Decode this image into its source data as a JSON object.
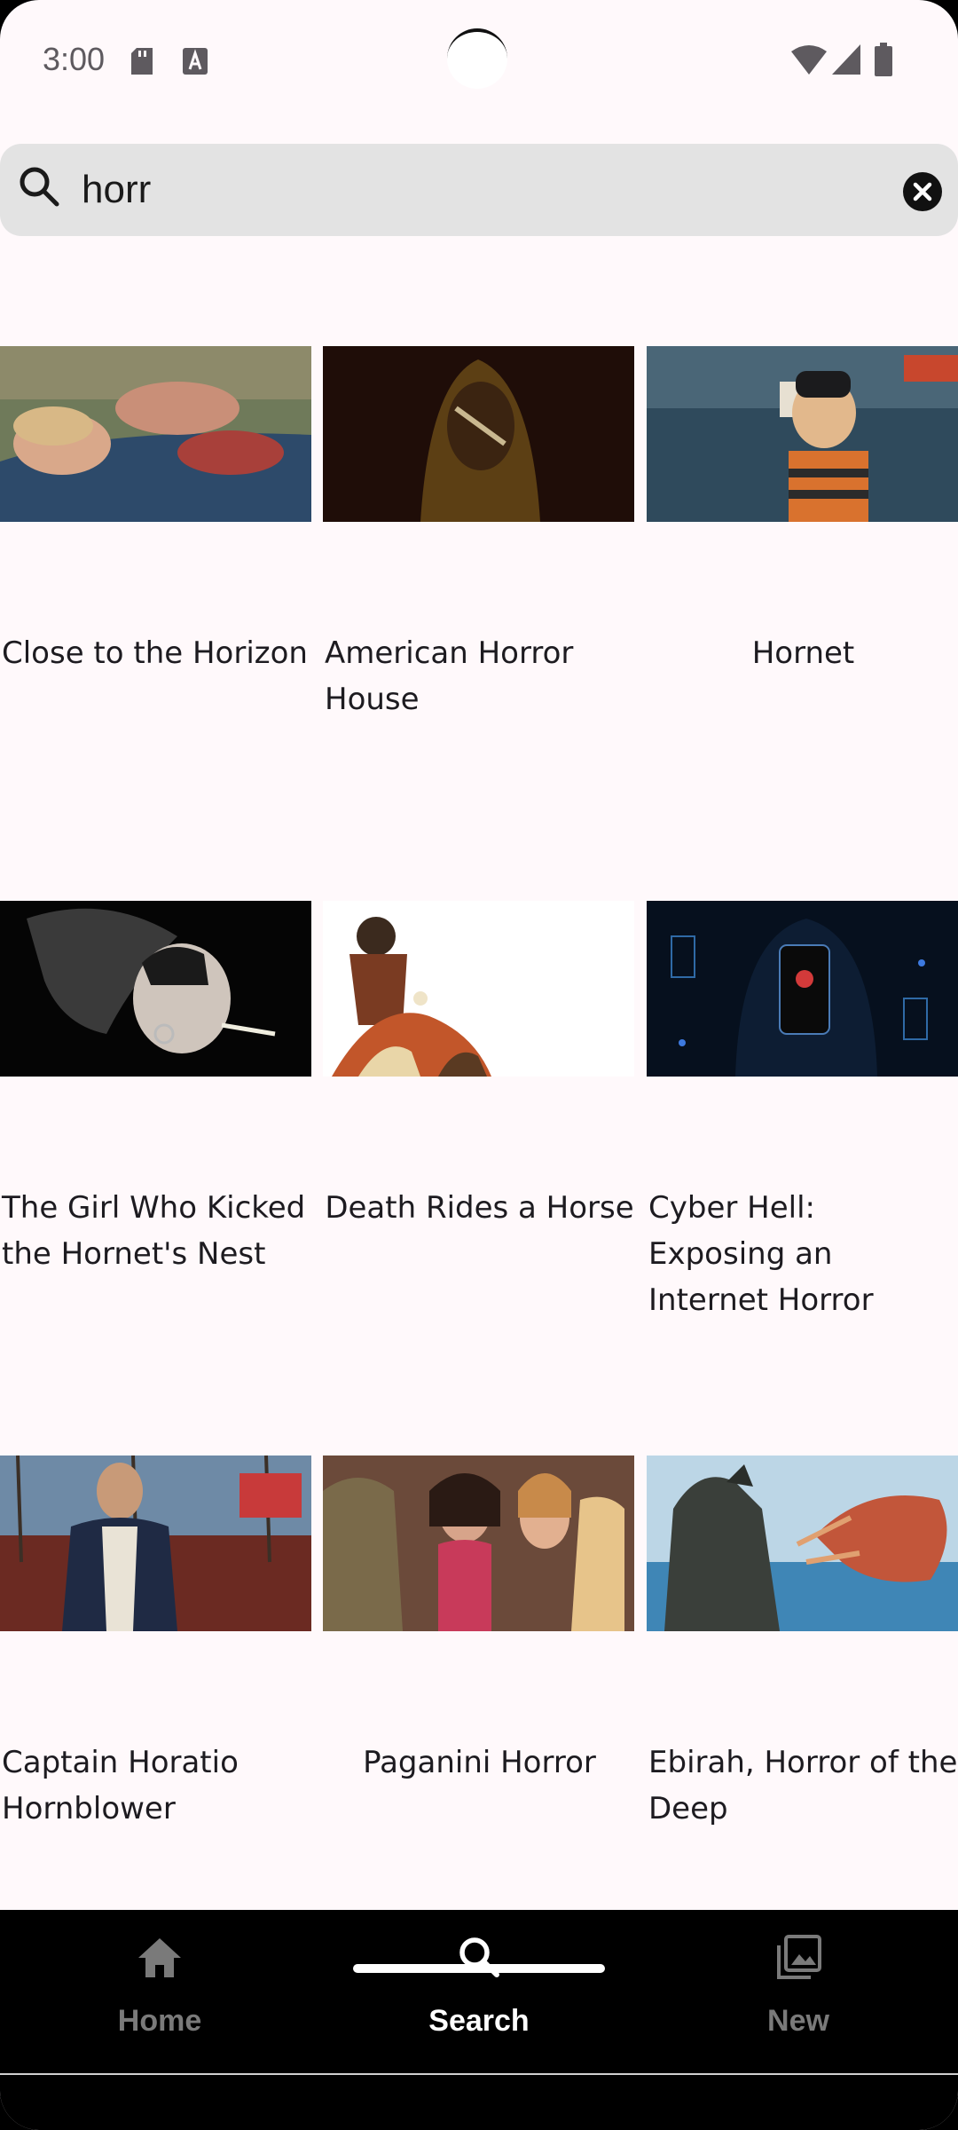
{
  "status_bar": {
    "time": "3:00"
  },
  "search": {
    "query": "horr",
    "placeholder": ""
  },
  "results": [
    {
      "title": "Close to the Horizon",
      "align": "left"
    },
    {
      "title": "American Horror House",
      "align": "left"
    },
    {
      "title": "Hornet",
      "align": "center"
    },
    {
      "title": "The Girl Who Kicked the Hornet's Nest",
      "align": "left"
    },
    {
      "title": "Death Rides a Horse",
      "align": "center"
    },
    {
      "title": "Cyber Hell: Exposing an Internet Horror",
      "align": "left"
    },
    {
      "title": "Captain Horatio Hornblower",
      "align": "left"
    },
    {
      "title": "Paganini Horror",
      "align": "center"
    },
    {
      "title": "Ebirah, Horror of the Deep",
      "align": "left"
    }
  ],
  "bottom_nav": {
    "items": [
      {
        "label": "Home",
        "icon": "home-icon",
        "active": false
      },
      {
        "label": "Search",
        "icon": "search-icon",
        "active": true
      },
      {
        "label": "New",
        "icon": "gallery-icon",
        "active": false
      }
    ]
  },
  "colors": {
    "background": "#fff9fb",
    "search_bar": "#e3e3e3",
    "nav_background": "#000000",
    "nav_active": "#ffffff",
    "nav_inactive": "#7a7a7a"
  }
}
